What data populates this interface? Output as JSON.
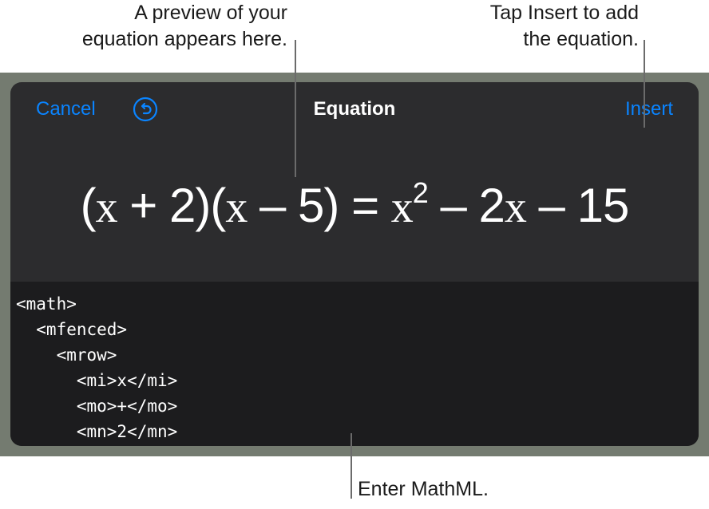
{
  "callouts": {
    "preview_line1": "A preview of your",
    "preview_line2": "equation appears here.",
    "insert_line1": "Tap Insert to add",
    "insert_line2": "the equation.",
    "mathml": "Enter MathML."
  },
  "toolbar": {
    "cancel_label": "Cancel",
    "title": "Equation",
    "insert_label": "Insert",
    "undo_icon": "undo-icon"
  },
  "equation": {
    "open1": "(",
    "x1": "x",
    "plus": " + 2",
    "close_open": ")(",
    "x2": "x",
    "minus5": " – 5) = ",
    "x3": "x",
    "exp": "2",
    "minus2": " – 2",
    "x4": "x",
    "tail": " – 15"
  },
  "editor": {
    "lines": [
      "<math>",
      "  <mfenced>",
      "    <mrow>",
      "      <mi>x</mi>",
      "      <mo>+</mo>",
      "      <mn>2</mn>"
    ]
  },
  "colors": {
    "accent": "#0a84ff",
    "sheet_bg": "#2c2c2e",
    "editor_bg": "#1c1c1e",
    "frame_bg": "#747b70"
  }
}
